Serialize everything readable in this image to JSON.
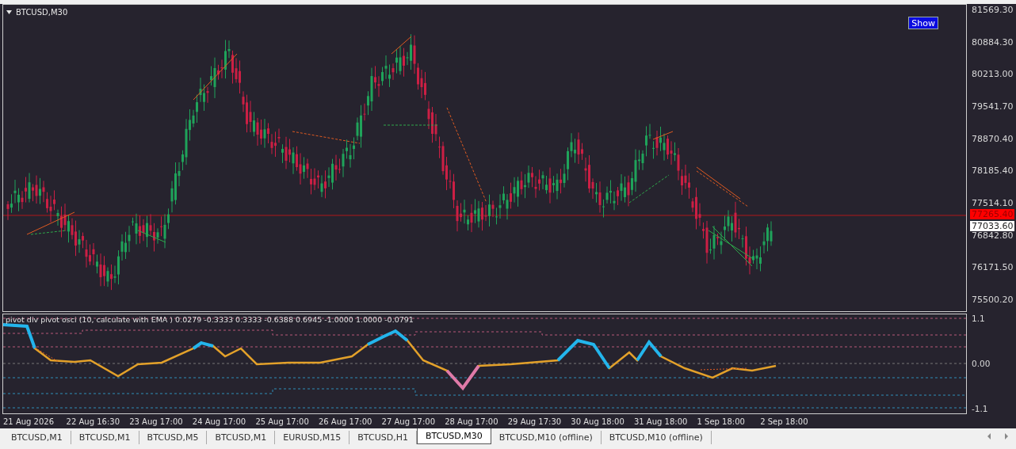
{
  "chart": {
    "title": "BTCUSD,M30",
    "button": "Show",
    "price_ticks": [
      "81569.30",
      "80884.30",
      "80213.00",
      "79541.70",
      "78870.40",
      "78185.40",
      "77514.10",
      "76842.80",
      "76171.50",
      "75500.20"
    ],
    "bid_label": "77265.40",
    "ask_label": "77033.60"
  },
  "indicator": {
    "label": "pivot div pivot osci (10, calculate with EMA ) 0.0279 -0.3333 0.3333 -0.6388 0.6945 -1.0000 1.0000 -0.0791",
    "ticks": [
      "1.1",
      "0.00",
      "-1.1"
    ]
  },
  "time_axis": [
    "21 Aug 2026",
    "22 Aug 16:30",
    "23 Aug 17:00",
    "24 Aug 17:00",
    "25 Aug 17:00",
    "26 Aug 17:00",
    "27 Aug 17:00",
    "28 Aug 17:00",
    "29 Aug 17:30",
    "30 Aug 18:00",
    "31 Aug 18:00",
    "1 Sep 18:00",
    "2 Sep 18:00"
  ],
  "tabs": [
    {
      "label": "BTCUSD,M1",
      "selected": false
    },
    {
      "label": "BTCUSD,M1",
      "selected": false
    },
    {
      "label": "BTCUSD,M5",
      "selected": false
    },
    {
      "label": "BTCUSD,M1",
      "selected": false
    },
    {
      "label": "EURUSD,M15",
      "selected": false
    },
    {
      "label": "BTCUSD,H1",
      "selected": false
    },
    {
      "label": "BTCUSD,M30",
      "selected": true
    },
    {
      "label": "BTCUSD,M10 (offline)",
      "selected": false
    },
    {
      "label": "BTCUSD,M10 (offline)",
      "selected": false
    }
  ]
}
